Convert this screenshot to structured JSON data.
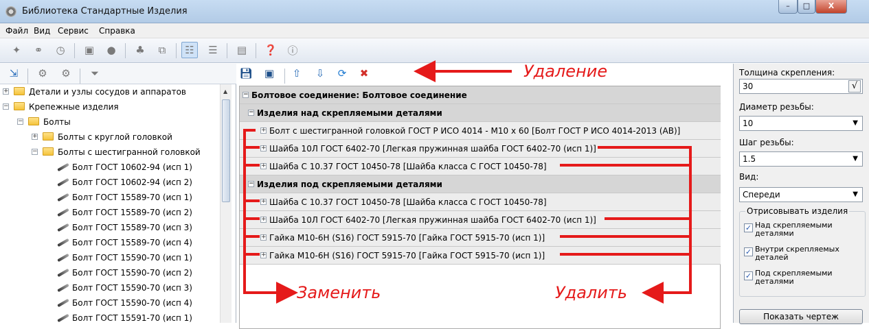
{
  "window": {
    "title": "Библиотека Стандартные Изделия",
    "controls": [
      "–",
      "□",
      "X"
    ]
  },
  "menu": [
    "Файл",
    "Вид",
    "Сервис",
    "Справка"
  ],
  "toolbar_icons": [
    "pin-icon",
    "binoculars-icon",
    "clock-icon",
    "save-icon",
    "disc-icon",
    "tree-icon",
    "export-icon",
    "view1-icon",
    "view2-icon",
    "grid-icon",
    "help-icon",
    "info-icon"
  ],
  "tree": {
    "items": [
      {
        "label": "Детали и узлы сосудов и аппаратов",
        "level": 0,
        "expander": "+",
        "kind": "folder"
      },
      {
        "label": "Крепежные изделия",
        "level": 0,
        "expander": "−",
        "kind": "folder"
      },
      {
        "label": "Болты",
        "level": 1,
        "expander": "−",
        "kind": "folder"
      },
      {
        "label": "Болты с круглой головкой",
        "level": 2,
        "expander": "+",
        "kind": "folder"
      },
      {
        "label": "Болты с шестигранной головкой",
        "level": 2,
        "expander": "−",
        "kind": "folder"
      },
      {
        "label": "Болт ГОСТ 10602-94 (исп 1)",
        "level": 3,
        "kind": "bolt"
      },
      {
        "label": "Болт ГОСТ 10602-94 (исп 2)",
        "level": 3,
        "kind": "bolt"
      },
      {
        "label": "Болт ГОСТ 15589-70 (исп 1)",
        "level": 3,
        "kind": "bolt"
      },
      {
        "label": "Болт ГОСТ 15589-70 (исп 2)",
        "level": 3,
        "kind": "bolt"
      },
      {
        "label": "Болт ГОСТ 15589-70 (исп 3)",
        "level": 3,
        "kind": "bolt"
      },
      {
        "label": "Болт ГОСТ 15589-70 (исп 4)",
        "level": 3,
        "kind": "bolt"
      },
      {
        "label": "Болт ГОСТ 15590-70 (исп 1)",
        "level": 3,
        "kind": "bolt"
      },
      {
        "label": "Болт ГОСТ 15590-70 (исп 2)",
        "level": 3,
        "kind": "bolt"
      },
      {
        "label": "Болт ГОСТ 15590-70 (исп 3)",
        "level": 3,
        "kind": "bolt"
      },
      {
        "label": "Болт ГОСТ 15590-70 (исп 4)",
        "level": 3,
        "kind": "bolt"
      },
      {
        "label": "Болт ГОСТ 15591-70 (исп 1)",
        "level": 3,
        "kind": "bolt"
      }
    ]
  },
  "connection": {
    "root": "Болтовое соединение: Болтовое соединение",
    "groups": [
      {
        "title": "Изделия над скрепляемыми деталями",
        "items": [
          "Болт с шестигранной головкой ГОСТ Р ИСО 4014 - М10 х 60    [Болт ГОСТ Р ИСО 4014-2013 (АВ)]",
          "Шайба 10Л ГОСТ 6402-70    [Легкая пружинная шайба ГОСТ 6402-70 (исп 1)]",
          "Шайба С 10.37 ГОСТ 10450-78    [Шайба класса С ГОСТ 10450-78]"
        ]
      },
      {
        "title": "Изделия под скрепляемыми деталями",
        "items": [
          "Шайба С 10.37 ГОСТ 10450-78    [Шайба класса С ГОСТ 10450-78]",
          "Шайба 10Л ГОСТ 6402-70    [Легкая пружинная шайба ГОСТ 6402-70 (исп 1)]",
          "Гайка М10-6Н (S16) ГОСТ 5915-70    [Гайка ГОСТ 5915-70 (исп 1)]",
          "Гайка М10-6Н (S16) ГОСТ 5915-70    [Гайка ГОСТ 5915-70 (исп 1)]"
        ]
      }
    ]
  },
  "params": {
    "thickness_label": "Толщина скрепления:",
    "thickness_value": "30",
    "thickness_check": "√",
    "diameter_label": "Диаметр резьбы:",
    "diameter_value": "10",
    "pitch_label": "Шаг резьбы:",
    "pitch_value": "1.5",
    "view_label": "Вид:",
    "view_value": "Спереди",
    "draw_group_title": "Отрисовывать изделия",
    "draw_options": [
      {
        "label": "Над скрепляемыми деталями",
        "checked": true
      },
      {
        "label": "Внутри скрепляемых деталей",
        "checked": true
      },
      {
        "label": "Под скрепляемыми деталями",
        "checked": true
      }
    ],
    "show_drawing_button": "Показать чертеж"
  },
  "annotations": {
    "delete_top": "Удаление",
    "replace": "Заменить",
    "delete_bottom": "Удалить",
    "color": "#e51a1a"
  }
}
